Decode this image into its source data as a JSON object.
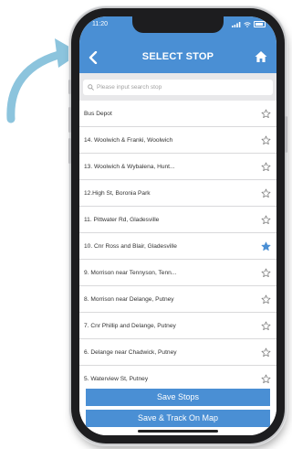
{
  "status_bar": {
    "time": "11:20"
  },
  "header": {
    "title": "SELECT STOP"
  },
  "search": {
    "placeholder": "Please input search stop"
  },
  "stops": [
    {
      "label": "Bus Depot",
      "starred": false
    },
    {
      "label": "14. Woolwich & Franki, Woolwich",
      "starred": false
    },
    {
      "label": "13. Woolwich & Wybalena, Hunt...",
      "starred": false
    },
    {
      "label": "12.High St, Boronia Park",
      "starred": false
    },
    {
      "label": "11. Pittwater Rd, Gladesville",
      "starred": false
    },
    {
      "label": "10. Cnr Ross and Blair, Gladesville",
      "starred": true
    },
    {
      "label": "9. Morrison near Tennyson, Tenn...",
      "starred": false
    },
    {
      "label": "8. Morrison near Delange, Putney",
      "starred": false
    },
    {
      "label": "7. Cnr Phillip and Delange, Putney",
      "starred": false
    },
    {
      "label": "6. Delange near Chadwick, Putney",
      "starred": false
    },
    {
      "label": "5. Waterview St, Putney",
      "starred": false
    }
  ],
  "footer": {
    "save_stops_label": "Save Stops",
    "save_track_label": "Save & Track On Map"
  },
  "colors": {
    "accent": "#4a8fd4",
    "star_filled": "#4a8fd4",
    "arrow": "#8cc4dd"
  },
  "icons": {
    "back": "chevron-left-icon",
    "home": "home-icon",
    "search": "search-icon",
    "star": "star-icon"
  }
}
